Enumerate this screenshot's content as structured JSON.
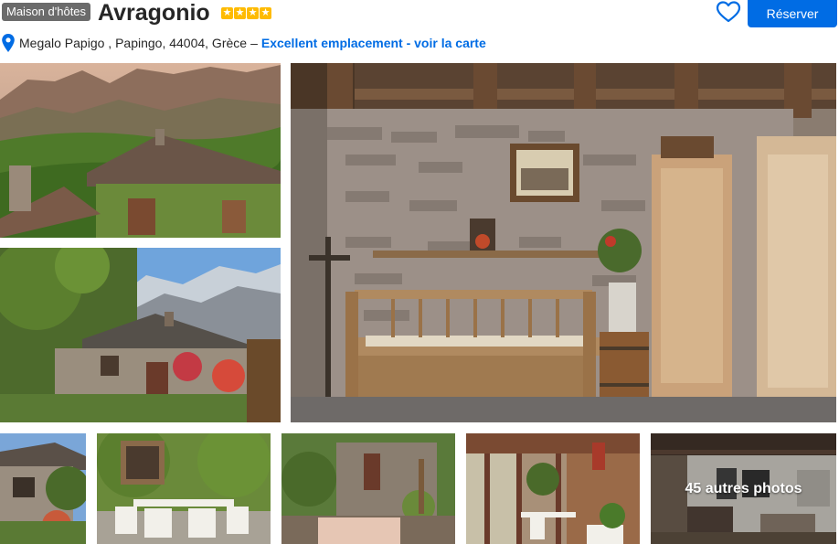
{
  "property": {
    "type_badge": "Maison d'hôtes",
    "name": "Avragonio",
    "star_count": 4,
    "star_color": "#febb02"
  },
  "actions": {
    "favorite_icon": "heart-outline-icon",
    "reserve_label": "Réserver"
  },
  "location": {
    "pin_icon": "map-pin-icon",
    "address": "Megalo Papigo , Papingo, 44004, Grèce",
    "separator": "–",
    "map_link": "Excellent emplacement - voir la carte"
  },
  "gallery": {
    "more_photos_label": "45 autres photos"
  },
  "colors": {
    "brand_blue": "#006ce4",
    "badge_gray": "#6b6b6b"
  }
}
